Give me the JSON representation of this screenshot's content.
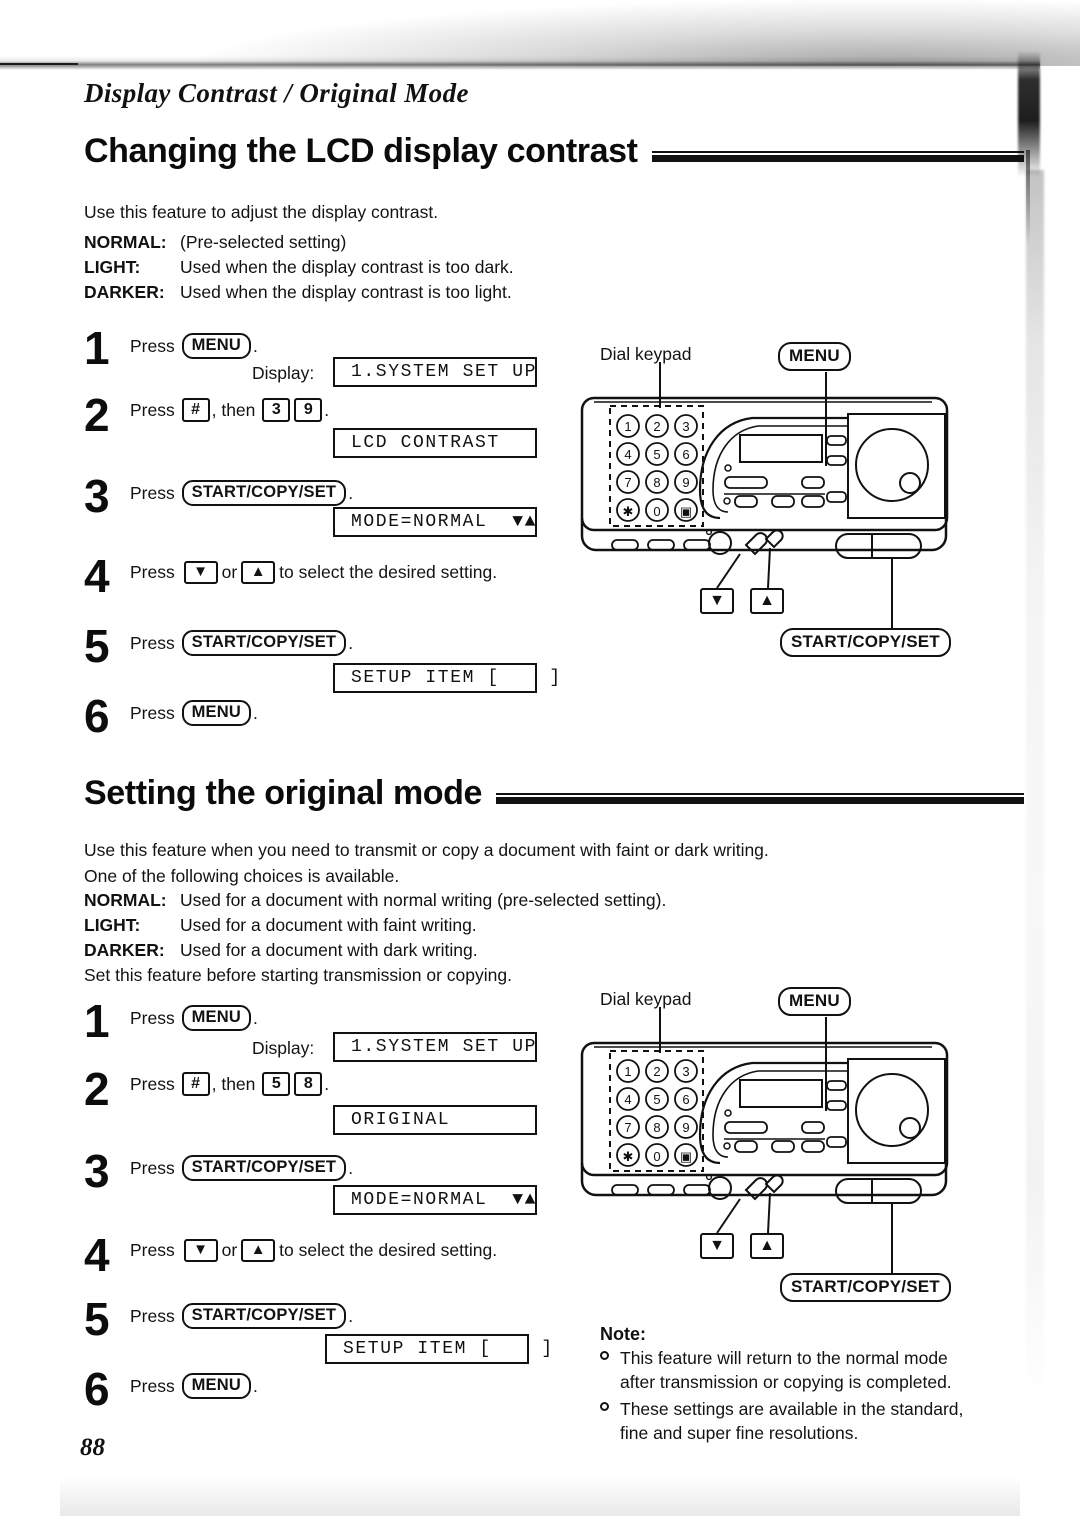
{
  "page": {
    "running_head": "Display Contrast / Original Mode",
    "page_number": "88"
  },
  "section1": {
    "heading": "Changing the LCD display contrast",
    "intro": "Use this feature to adjust the display contrast.",
    "definitions": [
      {
        "term": "NORMAL:",
        "desc": "(Pre-selected setting)"
      },
      {
        "term": "LIGHT:",
        "desc": "Used when the display contrast is too dark."
      },
      {
        "term": "DARKER:",
        "desc": "Used when the display contrast is too light."
      }
    ],
    "steps": [
      {
        "num": "1",
        "press": "Press",
        "key": "MENU",
        "tail": "."
      },
      {
        "num": "2",
        "press": "Press",
        "key": "#",
        "mid": ", then",
        "d1": "3",
        "d2": "9",
        "tail": "."
      },
      {
        "num": "3",
        "press": "Press",
        "key": "START/COPY/SET",
        "tail": "."
      },
      {
        "num": "4",
        "press": "Press",
        "down": "▼",
        "or": "or",
        "up": "▲",
        "tail": "to select the desired setting."
      },
      {
        "num": "5",
        "press": "Press",
        "key": "START/COPY/SET",
        "tail": "."
      },
      {
        "num": "6",
        "press": "Press",
        "key": "MENU",
        "tail": "."
      }
    ],
    "display_label": "Display:",
    "lcds": [
      "1.SYSTEM SET UP",
      "LCD CONTRAST",
      "MODE=NORMAL  ▼▲",
      "SETUP ITEM [    ]"
    ]
  },
  "section2": {
    "heading": "Setting the original mode",
    "intro1": "Use this feature when you need to transmit or copy a document with faint or dark writing.",
    "intro2": "One of the following choices is available.",
    "definitions": [
      {
        "term": "NORMAL:",
        "desc": "Used for a document with normal writing (pre-selected setting)."
      },
      {
        "term": "LIGHT:",
        "desc": "Used for a document with faint writing."
      },
      {
        "term": "DARKER:",
        "desc": "Used for a document with dark writing."
      }
    ],
    "outro": "Set this feature before starting transmission or copying.",
    "steps": [
      {
        "num": "1",
        "press": "Press",
        "key": "MENU",
        "tail": "."
      },
      {
        "num": "2",
        "press": "Press",
        "key": "#",
        "mid": ", then",
        "d1": "5",
        "d2": "8",
        "tail": "."
      },
      {
        "num": "3",
        "press": "Press",
        "key": "START/COPY/SET",
        "tail": "."
      },
      {
        "num": "4",
        "press": "Press",
        "down": "▼",
        "or": "or",
        "up": "▲",
        "tail": "to select the desired setting."
      },
      {
        "num": "5",
        "press": "Press",
        "key": "START/COPY/SET",
        "tail": "."
      },
      {
        "num": "6",
        "press": "Press",
        "key": "MENU",
        "tail": "."
      }
    ],
    "display_label": "Display:",
    "lcds": [
      "1.SYSTEM SET UP",
      "ORIGINAL",
      "MODE=NORMAL  ▼▲",
      "SETUP ITEM [    ]"
    ]
  },
  "figure": {
    "dial_keypad_label": "Dial keypad",
    "menu_callout": "MENU",
    "start_callout": "START/COPY/SET",
    "down_callout": "▼",
    "up_callout": "▲",
    "keypad_keys": [
      "1",
      "2",
      "3",
      "4",
      "5",
      "6",
      "7",
      "8",
      "9",
      "✱",
      "0",
      "▣"
    ]
  },
  "note": {
    "title": "Note:",
    "items": [
      "This feature will return to the normal mode after transmission or copying is completed.",
      "These settings are available in the standard, fine and super fine resolutions."
    ]
  }
}
